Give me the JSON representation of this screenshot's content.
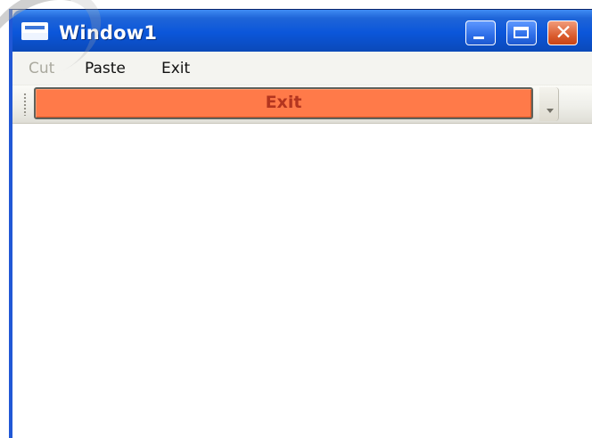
{
  "window": {
    "title": "Window1"
  },
  "menu": {
    "items": [
      {
        "label": "Cut",
        "enabled": false
      },
      {
        "label": "Paste",
        "enabled": true
      },
      {
        "label": "Exit",
        "enabled": true
      }
    ]
  },
  "toolbar": {
    "exit_label": "Exit"
  },
  "colors": {
    "titlebar": "#0b56da",
    "exit_button": "#ff7a49",
    "exit_text": "#b3351f",
    "close_button": "#d95a2c"
  },
  "icons": {
    "app": "window-icon",
    "minimize": "minimize-icon",
    "maximize": "maximize-icon",
    "close": "close-icon",
    "toolbar_grip": "grip-icon",
    "toolbar_overflow": "chevron-down-icon"
  },
  "controls": {
    "minimize": "",
    "maximize": "",
    "close": "✕"
  }
}
